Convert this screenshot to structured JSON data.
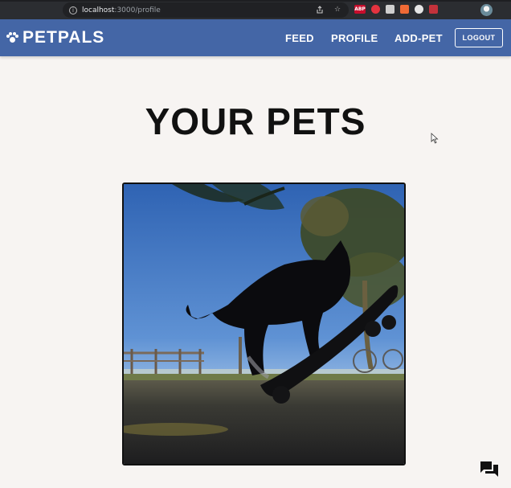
{
  "browser": {
    "url_host": "localhost",
    "url_path": ":3000/profile",
    "extensions": [
      "ABP",
      "",
      "",
      "",
      "",
      ""
    ]
  },
  "navbar": {
    "brand": "PETPALS",
    "links": [
      "FEED",
      "PROFILE",
      "ADD-PET"
    ],
    "logout": "LOGOUT",
    "color": "#4466a6"
  },
  "main": {
    "title": "YOUR PETS",
    "pet_image": "cat-on-skateboard-photo"
  },
  "icons": {
    "brand_icon": "paw-icon",
    "chat_icon": "forum-icon",
    "cursor": "mouse-pointer-icon"
  }
}
